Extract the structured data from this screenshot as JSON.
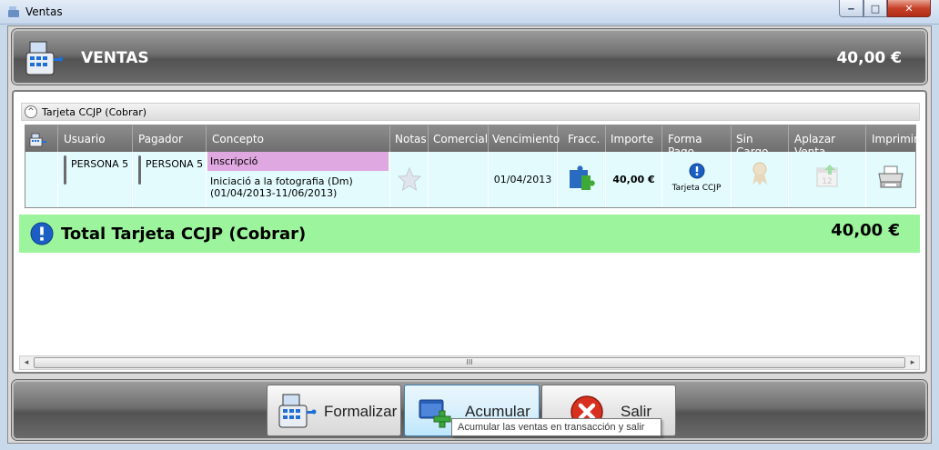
{
  "window": {
    "title": "Ventas",
    "minimize_label": "‒",
    "maximize_label": "□",
    "close_label": "✕"
  },
  "header": {
    "title": "VENTAS",
    "amount": "40,00 €"
  },
  "group": {
    "label": "Tarjeta CCJP (Cobrar)",
    "collapse_glyph": "^"
  },
  "columns": [
    "Usuario",
    "Pagador",
    "Concepto",
    "Notas",
    "Comercial",
    "Vencimiento",
    "Fracc.",
    "Importe",
    "Forma Pago",
    "Sin Cargo",
    "Aplazar Venta",
    "Imprimir"
  ],
  "row": {
    "usuario": "PERSONA 5",
    "pagador": "PERSONA 5",
    "concepto_tag": "Inscripció",
    "concepto_line1": "Iniciació a la fotografia (Dm)",
    "concepto_line2": "(01/04/2013-11/06/2013)",
    "vencimiento": "01/04/2013",
    "importe": "40,00 €",
    "forma_pago": "Tarjeta CCJP"
  },
  "total": {
    "label": "Total  Tarjeta CCJP (Cobrar)",
    "amount": "40,00 €"
  },
  "scroll": {
    "left": "◂",
    "thumb": "III",
    "right": "▸"
  },
  "buttons": {
    "formalizar": "Formalizar",
    "acumular": "Acumular",
    "salir": "Salir"
  },
  "tooltip": "Acumular las ventas en transacción y salir",
  "colors": {
    "concept_tag": "#e0a8e0",
    "row_bg": "#e3fbfd",
    "total_bg": "#9cf59c"
  }
}
